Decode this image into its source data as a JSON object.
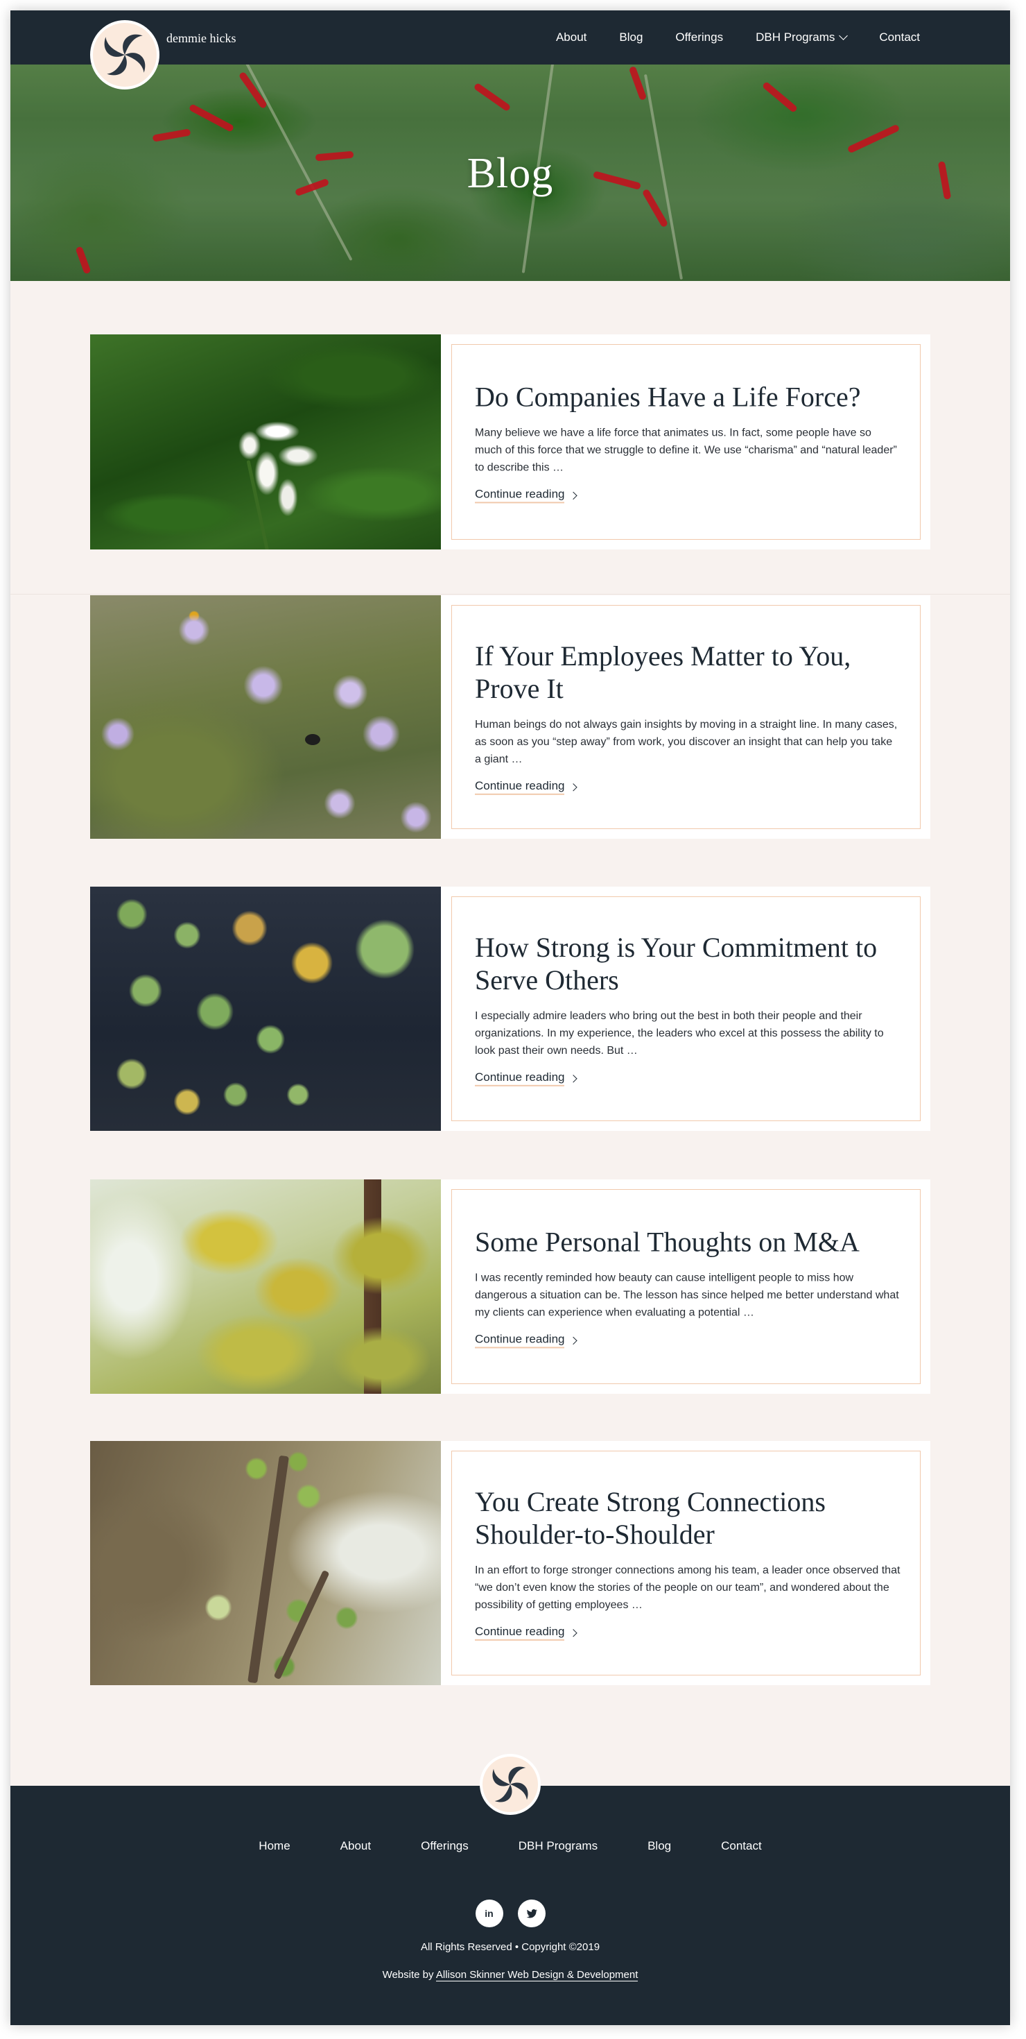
{
  "header": {
    "brand": "demmie hicks",
    "nav": [
      {
        "label": "About"
      },
      {
        "label": "Blog"
      },
      {
        "label": "Offerings"
      },
      {
        "label": "DBH Programs"
      },
      {
        "label": "Contact"
      }
    ]
  },
  "hero": {
    "title": "Blog"
  },
  "posts": [
    {
      "title": "Do Companies Have a Life Force?",
      "excerpt": "Many believe we have a life force that animates us. In fact, some people have so much of this force that we struggle to define it. We use “charisma” and “natural leader” to describe this …",
      "link": "Continue reading"
    },
    {
      "title": "If Your Employees Matter to You, Prove It",
      "excerpt": "Human beings do not always gain insights by moving in a straight line. In many cases, as soon as you “step away” from work, you discover an insight that can help you take a giant …",
      "link": "Continue reading"
    },
    {
      "title": "How Strong is Your Commitment to Serve Others",
      "excerpt": "I especially admire leaders who bring out the best in both their people and their organizations. In my experience, the leaders who excel at this possess the ability to look past their own needs. But …",
      "link": "Continue reading"
    },
    {
      "title": "Some Personal Thoughts on M&A",
      "excerpt": "I was recently reminded how beauty can cause intelligent people to miss how dangerous a situation can be. The lesson has since helped me better understand what my clients can experience when evaluating a potential …",
      "link": "Continue reading"
    },
    {
      "title": "You Create Strong Connections Shoulder-to-Shoulder",
      "excerpt": "In an effort to forge stronger connections among his team, a leader once observed that “we don’t even know the stories of the people on our team”, and wondered about the possibility of getting employees …",
      "link": "Continue reading"
    }
  ],
  "footer": {
    "nav": [
      {
        "label": "Home"
      },
      {
        "label": "About"
      },
      {
        "label": "Offerings"
      },
      {
        "label": "DBH Programs"
      },
      {
        "label": "Blog"
      },
      {
        "label": "Contact"
      }
    ],
    "social": [
      {
        "icon": "linkedin-icon",
        "text": "in"
      },
      {
        "icon": "twitter-icon"
      }
    ],
    "copyright": "All Rights Reserved • Copyright ©2019",
    "credit_prefix": "Website by",
    "credit_link": "Allison Skinner Web Design & Development"
  },
  "colors": {
    "navy": "#1e2933",
    "cream": "#f8f2ef",
    "peach_accent": "#f1c9ac",
    "logo_bg": "#fbeadd"
  }
}
